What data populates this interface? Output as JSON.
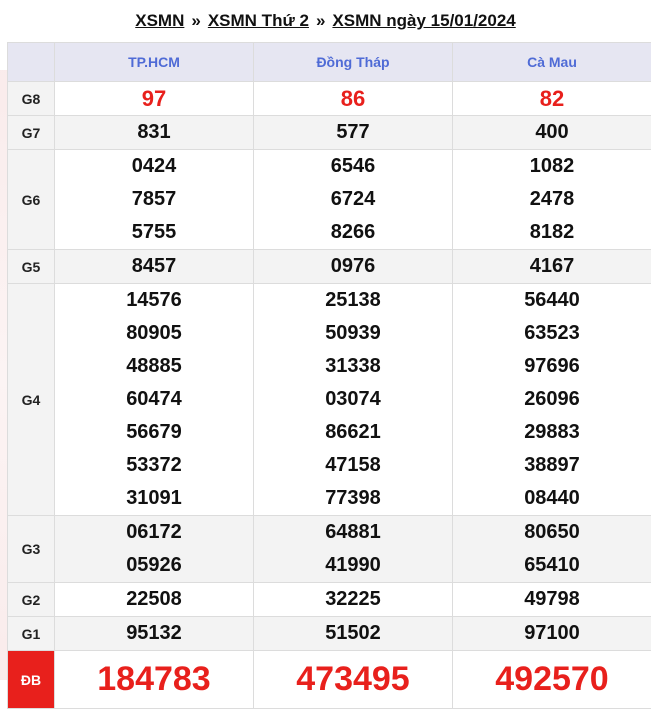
{
  "breadcrumb": {
    "items": [
      "XSMN",
      "XSMN Thứ 2",
      "XSMN ngày 15/01/2024"
    ],
    "separator": "»"
  },
  "provinces": [
    "TP.HCM",
    "Đồng Tháp",
    "Cà Mau"
  ],
  "prizes": [
    {
      "label": "G8",
      "values": [
        [
          "97"
        ],
        [
          "86"
        ],
        [
          "82"
        ]
      ]
    },
    {
      "label": "G7",
      "values": [
        [
          "831"
        ],
        [
          "577"
        ],
        [
          "400"
        ]
      ]
    },
    {
      "label": "G6",
      "values": [
        [
          "0424",
          "7857",
          "5755"
        ],
        [
          "6546",
          "6724",
          "8266"
        ],
        [
          "1082",
          "2478",
          "8182"
        ]
      ]
    },
    {
      "label": "G5",
      "values": [
        [
          "8457"
        ],
        [
          "0976"
        ],
        [
          "4167"
        ]
      ]
    },
    {
      "label": "G4",
      "values": [
        [
          "14576",
          "80905",
          "48885",
          "60474",
          "56679",
          "53372",
          "31091"
        ],
        [
          "25138",
          "50939",
          "31338",
          "03074",
          "86621",
          "47158",
          "77398"
        ],
        [
          "56440",
          "63523",
          "97696",
          "26096",
          "29883",
          "38897",
          "08440"
        ]
      ]
    },
    {
      "label": "G3",
      "values": [
        [
          "06172",
          "05926"
        ],
        [
          "64881",
          "41990"
        ],
        [
          "80650",
          "65410"
        ]
      ]
    },
    {
      "label": "G2",
      "values": [
        [
          "22508"
        ],
        [
          "32225"
        ],
        [
          "49798"
        ]
      ]
    },
    {
      "label": "G1",
      "values": [
        [
          "95132"
        ],
        [
          "51502"
        ],
        [
          "97100"
        ]
      ]
    },
    {
      "label": "ĐB",
      "values": [
        [
          "184783"
        ],
        [
          "473495"
        ],
        [
          "492570"
        ]
      ]
    }
  ],
  "colors": {
    "accent_red": "#e8201c",
    "province_blue": "#4f6bd6",
    "header_bg": "#e6e6f2",
    "row_gray": "#f3f3f3"
  }
}
